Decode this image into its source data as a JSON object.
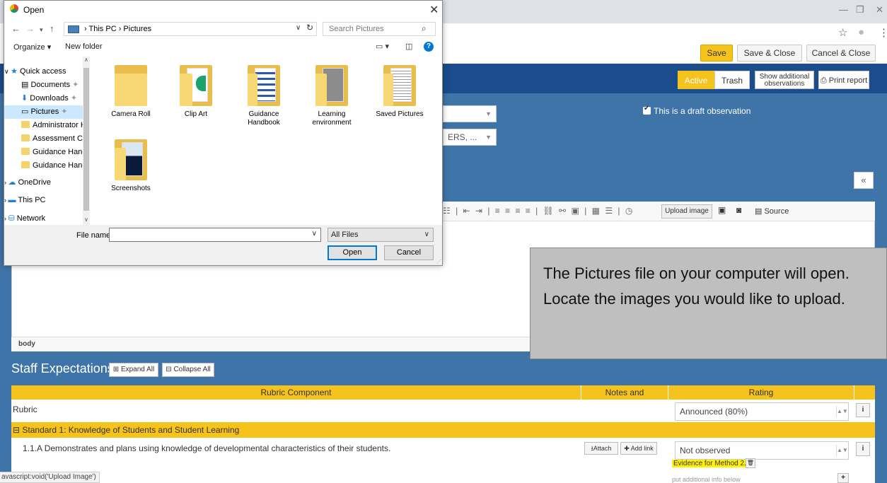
{
  "browser": {
    "controls": [
      "—",
      "❐",
      "✕"
    ],
    "addr_icons": [
      "☆",
      "●",
      "⋮"
    ]
  },
  "app": {
    "top_buttons": {
      "save": "Save",
      "save_close": "Save & Close",
      "cancel_close": "Cancel & Close"
    },
    "filter": {
      "active": "Active",
      "trash": "Trash",
      "show_additional_1": "Show additional",
      "show_additional_2": "observations",
      "print": "Print report"
    },
    "draft_label": "This is a draft observation",
    "select_2_value": "ERS, ...",
    "collapse_icon": "«",
    "editor": {
      "upload_image": "Upload image",
      "source": "Source",
      "status_body": "body",
      "toolbar_glyphs": "☷ | ⇤ ⇥ | ≡ ≡ ≡ ≡ | ⛓ ⚯ ▣ | ▦ ☰ | ◷"
    },
    "staff": {
      "title": "Staff Expectations",
      "expand": "⊞ Expand All",
      "collapse": "⊟ Collapse All"
    },
    "table": {
      "headers": [
        "Rubric Component",
        "Notes and Attachments",
        "Rating"
      ],
      "rubric_label": "Rubric",
      "rubric_rating": "Announced (80%)",
      "standard": "⊟ Standard 1: Knowledge of Students and Student Learning",
      "item": "1.1.A Demonstrates and plans using knowledge of developmental characteristics of their students.",
      "attach": "Attach",
      "add_link": "Add link",
      "item_rating": "Not observed",
      "evidence": "Evidence for Method 2.",
      "put_info": "put additional info below",
      "info": "i",
      "plus": "+"
    },
    "status_url": "avascript:void('Upload Image')"
  },
  "callout": "The Pictures file on your computer will open.  Locate the images you would like to upload.",
  "dialog": {
    "title": "Open",
    "close": "✕",
    "breadcrumb": "› This PC › Pictures",
    "search_placeholder": "Search Pictures",
    "organize": "Organize ▾",
    "new_folder": "New folder",
    "nav": {
      "quick_access": "Quick access",
      "documents": "Documents",
      "downloads": "Downloads",
      "pictures": "Pictures",
      "admin": "Administrator H",
      "assessment": "Assessment Cale",
      "guidance1": "Guidance Handb",
      "guidance2": "Guidance Handb",
      "onedrive": "OneDrive",
      "thispc": "This PC",
      "network": "Network"
    },
    "folders": [
      "Camera Roll",
      "Clip Art",
      "Guidance Handbook",
      "Learning environment",
      "Saved Pictures",
      "Screenshots"
    ],
    "file_name_label": "File name:",
    "file_type": "All Files",
    "open": "Open",
    "cancel": "Cancel"
  }
}
